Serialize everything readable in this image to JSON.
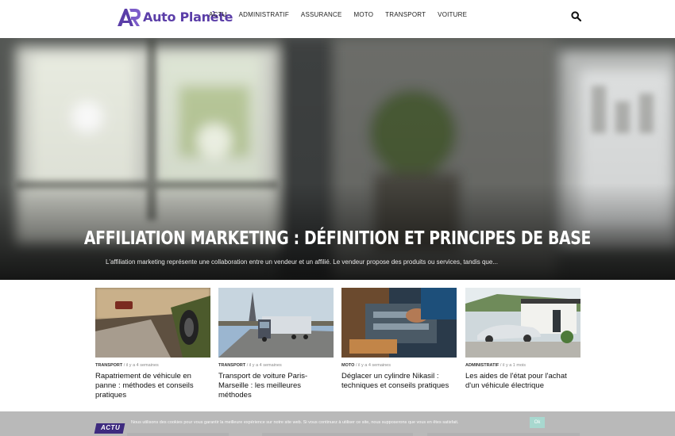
{
  "brand": {
    "name": "Auto Planète",
    "accent": "#5b3ea8"
  },
  "nav": {
    "items": [
      {
        "label": "ACTU"
      },
      {
        "label": "ADMINISTRATIF"
      },
      {
        "label": "ASSURANCE"
      },
      {
        "label": "MOTO"
      },
      {
        "label": "TRANSPORT"
      },
      {
        "label": "VOITURE"
      }
    ],
    "search_icon": "search-icon"
  },
  "hero": {
    "title": "AFFILIATION MARKETING : DÉFINITION ET PRINCIPES DE BASE",
    "excerpt": "L'affiliation marketing représente une collaboration entre un vendeur et un affilié. Le vendeur propose des produits ou services, tandis que..."
  },
  "cards": [
    {
      "category": "TRANSPORT",
      "separator": "/",
      "time": "il y a 4 semaines",
      "title": "Rapatriement de véhicule en panne : méthodes et conseils pratiques"
    },
    {
      "category": "TRANSPORT",
      "separator": "/",
      "time": "il y a 4 semaines",
      "title": "Transport de voiture Paris-Marseille : les meilleures méthodes"
    },
    {
      "category": "MOTO",
      "separator": "/",
      "time": "il y a 4 semaines",
      "title": "Déglacer un cylindre Nikasil : techniques et conseils pratiques"
    },
    {
      "category": "ADMINISTRATIF",
      "separator": "/",
      "time": "il y a 1 mois",
      "title": "Les aides de l'état pour l'achat d'un véhicule électrique"
    }
  ],
  "cookie": {
    "text": "Nous utilisons des cookies pour vous garantir la meilleure expérience sur notre site web. Si vous continuez à utiliser ce site, nous supposerons que vous en êtes satisfait.",
    "ok_label": "Ok",
    "ok_color": "#a8d8cf"
  },
  "section": {
    "label": "ACTU",
    "color": "#3e2b7f"
  }
}
